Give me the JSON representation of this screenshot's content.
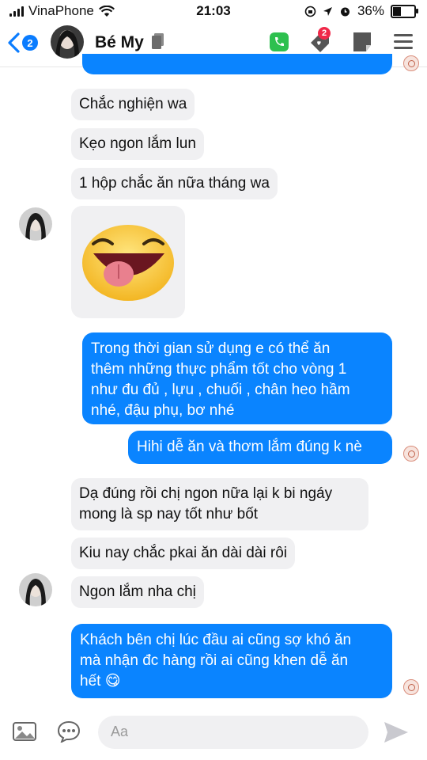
{
  "status_bar": {
    "carrier": "VinaPhone",
    "time": "21:03",
    "battery_percent": "36%",
    "battery_level": 0.36
  },
  "header": {
    "back_badge_count": "2",
    "contact_name": "Bé My",
    "notification_badge": "2"
  },
  "messages": [
    {
      "side": "in",
      "text": "Chắc nghiện wa"
    },
    {
      "side": "in",
      "text": "Kẹo ngon lắm lun"
    },
    {
      "side": "in",
      "text": "1 hộp chắc ăn nữa tháng wa"
    },
    {
      "side": "in",
      "sticker": "tongue-out-emoji-sticker"
    },
    {
      "side": "out",
      "lines": [
        "Trong thời gian sử dụng e có thể ăn",
        "thêm những thực phẩm tốt cho vòng 1",
        "như đu đủ , lựu , chuối , chân  heo hầm",
        "nhé, đậu phụ, bơ nhé"
      ]
    },
    {
      "side": "out",
      "text": "Hihi dễ ăn và thơm lắm đúng k nè"
    },
    {
      "side": "in",
      "lines": [
        "Dạ đúng rồi chị ngon nữa lại k bi ngáy",
        "mong là sp nay tốt như bốt"
      ]
    },
    {
      "side": "in",
      "text": "Kiu nay chắc pkai ăn dài dài rôi"
    },
    {
      "side": "in",
      "text": "Ngon lắm nha chị"
    },
    {
      "side": "out",
      "lines": [
        "Khách bên chị lúc đầu ai cũng sợ khó ăn",
        "mà nhận đc hàng rồi ai cũng khen dễ ăn",
        "hết 😋"
      ]
    }
  ],
  "composer": {
    "placeholder": "Aa"
  },
  "colors": {
    "outgoing_bubble": "#0a84ff",
    "incoming_bubble": "#f0f0f2",
    "accent": "#0a7cff",
    "call_green": "#2ec04f",
    "badge_red": "#f02849"
  }
}
